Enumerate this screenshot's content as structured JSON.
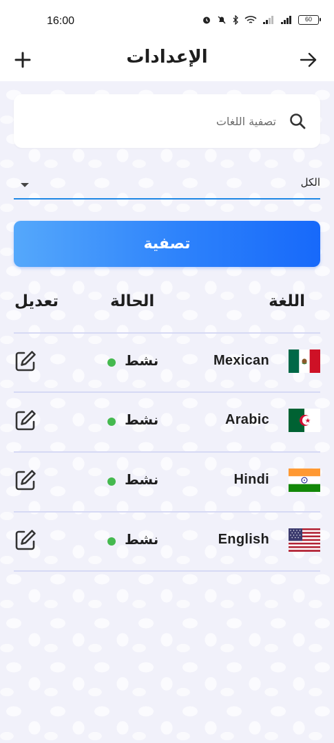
{
  "status_bar": {
    "time": "16:00",
    "battery": "60"
  },
  "app_bar": {
    "title": "الإعدادات"
  },
  "search": {
    "placeholder": "تصفية اللغات",
    "value": ""
  },
  "filter_select": {
    "value": "الكل"
  },
  "filter_button": {
    "label": "تصفية"
  },
  "table": {
    "headers": {
      "language": "اللغة",
      "status": "الحالة",
      "edit": "تعديل"
    },
    "rows": [
      {
        "name": "Mexican",
        "status": "نشط",
        "flag": "mexico-flag-icon"
      },
      {
        "name": "Arabic",
        "status": "نشط",
        "flag": "algeria-flag-icon"
      },
      {
        "name": "Hindi",
        "status": "نشط",
        "flag": "india-flag-icon"
      },
      {
        "name": "English",
        "status": "نشط",
        "flag": "usa-flag-icon"
      }
    ]
  },
  "colors": {
    "accent": "#1e88e5",
    "button_start": "#55a8fb",
    "button_end": "#1769fa",
    "active_dot": "#45b94f",
    "divider": "#d6d9f4"
  }
}
